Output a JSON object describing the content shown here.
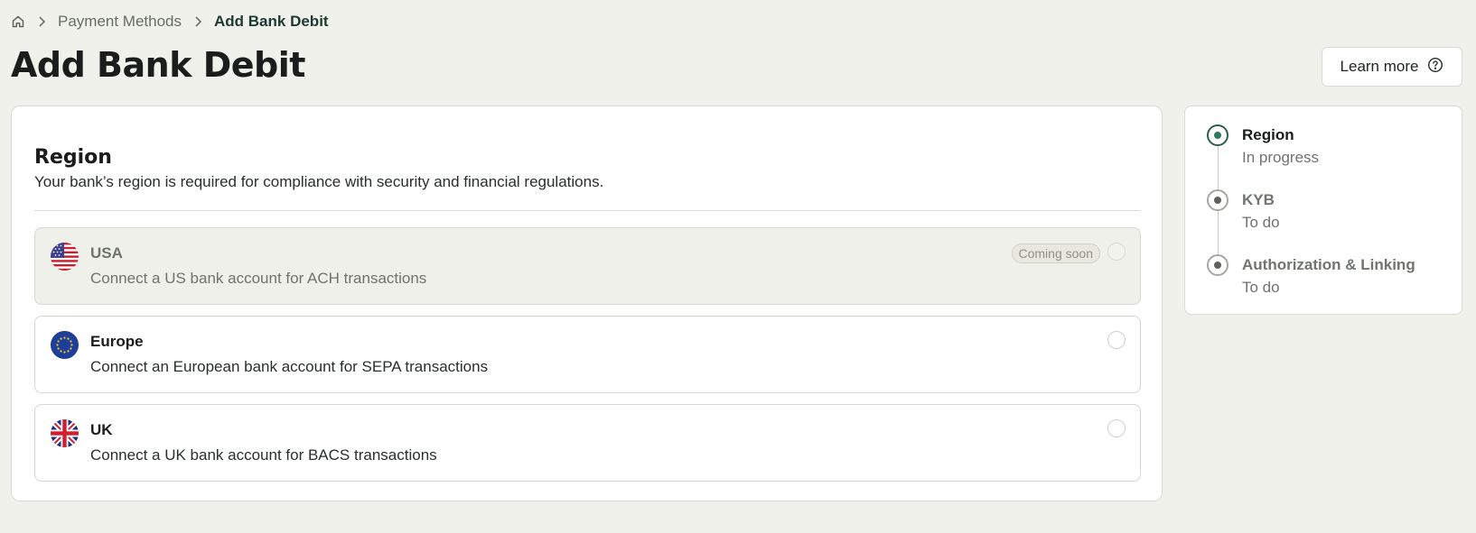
{
  "breadcrumb": {
    "items": [
      "Payment Methods",
      "Add Bank Debit"
    ]
  },
  "header": {
    "title": "Add Bank Debit",
    "learn_more_label": "Learn more"
  },
  "region": {
    "title": "Region",
    "description": "Your bank’s region is required for compliance with security and financial regulations.",
    "options": [
      {
        "title": "USA",
        "description": "Connect a US bank account for ACH transactions",
        "badge": "Coming soon",
        "disabled": true
      },
      {
        "title": "Europe",
        "description": "Connect an European bank account for SEPA transactions"
      },
      {
        "title": "UK",
        "description": "Connect a UK bank account for BACS transactions"
      }
    ]
  },
  "steps": [
    {
      "label": "Region",
      "status": "In progress",
      "active": true
    },
    {
      "label": "KYB",
      "status": "To do"
    },
    {
      "label": "Authorization & Linking",
      "status": "To do"
    }
  ],
  "colors": {
    "background": "#f1f1ec",
    "accent": "#2e7a63"
  },
  "icons": [
    "home-icon",
    "chevron-right-icon",
    "help-circle-icon",
    "usa-flag-icon",
    "eu-flag-icon",
    "uk-flag-icon"
  ]
}
